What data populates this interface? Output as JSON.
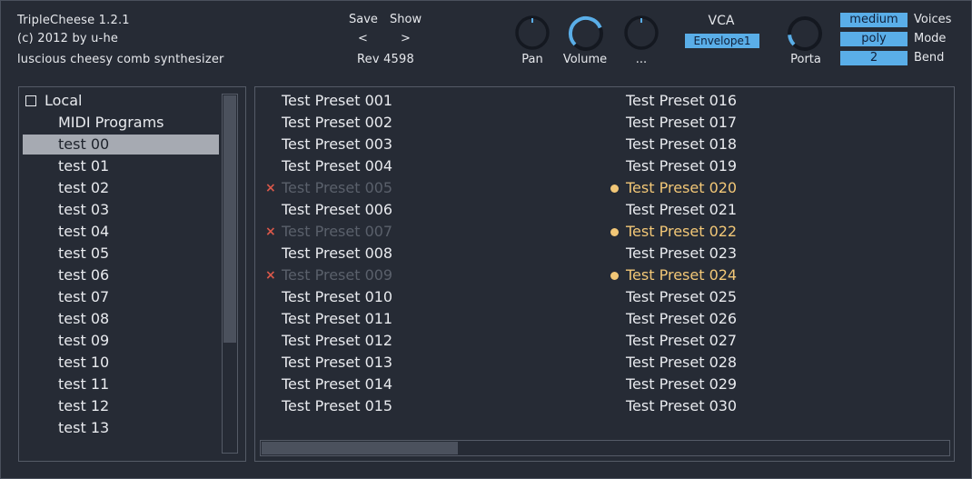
{
  "header": {
    "app_title": "TripleCheese 1.2.1",
    "copyright": "(c) 2012 by u-he",
    "tagline": "luscious cheesy comb synthesizer",
    "save_label": "Save",
    "show_label": "Show",
    "prev_label": "<",
    "next_label": ">",
    "revision": "Rev 4598"
  },
  "knobs": {
    "pan": {
      "label": "Pan",
      "level": 0.5
    },
    "volume": {
      "label": "Volume",
      "level": 0.75
    },
    "extra": {
      "label": "...",
      "level": 0.5
    },
    "porta": {
      "label": "Porta",
      "level": 0.15
    }
  },
  "vca": {
    "title": "VCA",
    "value": "Envelope1"
  },
  "settings": {
    "voices": {
      "value": "medium",
      "label": "Voices"
    },
    "mode": {
      "value": "poly",
      "label": "Mode"
    },
    "bend": {
      "value": "2",
      "label": "Bend"
    }
  },
  "tree": {
    "root": "Local",
    "midi": "MIDI Programs",
    "items": [
      "test 00",
      "test 01",
      "test 02",
      "test 03",
      "test 04",
      "test 05",
      "test 06",
      "test 07",
      "test 08",
      "test 09",
      "test 10",
      "test 11",
      "test 12",
      "test 13"
    ],
    "selected_index": 0
  },
  "presets": {
    "col1": [
      "Test Preset 001",
      "Test Preset 002",
      "Test Preset 003",
      "Test Preset 004",
      "Test Preset 005",
      "Test Preset 006",
      "Test Preset 007",
      "Test Preset 008",
      "Test Preset 009",
      "Test Preset 010",
      "Test Preset 011",
      "Test Preset 012",
      "Test Preset 013",
      "Test Preset 014",
      "Test Preset 015"
    ],
    "col2": [
      "Test Preset 016",
      "Test Preset 017",
      "Test Preset 018",
      "Test Preset 019",
      "Test Preset 020",
      "Test Preset 021",
      "Test Preset 022",
      "Test Preset 023",
      "Test Preset 024",
      "Test Preset 025",
      "Test Preset 026",
      "Test Preset 027",
      "Test Preset 028",
      "Test Preset 029",
      "Test Preset 030"
    ],
    "disabled": [
      "Test Preset 005",
      "Test Preset 007",
      "Test Preset 009"
    ],
    "favorites": [
      "Test Preset 020",
      "Test Preset 022",
      "Test Preset 024"
    ],
    "disabled_mark": "×"
  },
  "colors": {
    "accent": "#5aaee8",
    "favorite": "#f2c777",
    "disabled_mark": "#d9584a",
    "background": "#262b35"
  }
}
